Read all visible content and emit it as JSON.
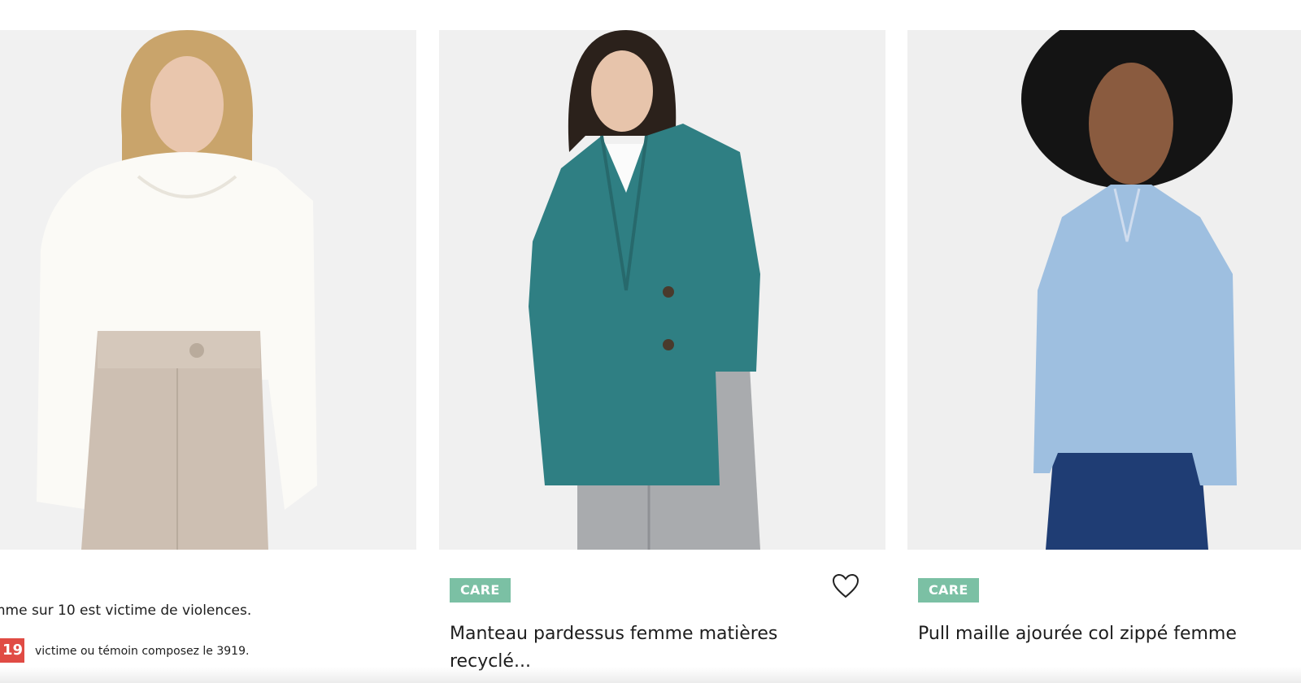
{
  "cards": [
    {
      "campaign_line": "mme sur 10 est victime de violences.",
      "campaign_number": "19",
      "campaign_sub": "victime ou témoin composez le 3919."
    },
    {
      "badge": "CARE",
      "title": "Manteau pardessus femme matières recyclé...",
      "wishlist_icon": "heart-outline-icon"
    },
    {
      "badge": "CARE",
      "title": "Pull maille ajourée col zippé femme"
    }
  ],
  "colors": {
    "badge": "#7bc0a4",
    "campaign_red": "#e04b44",
    "coat": "#2f7f83",
    "sweater_blue": "#9ebfe0"
  }
}
